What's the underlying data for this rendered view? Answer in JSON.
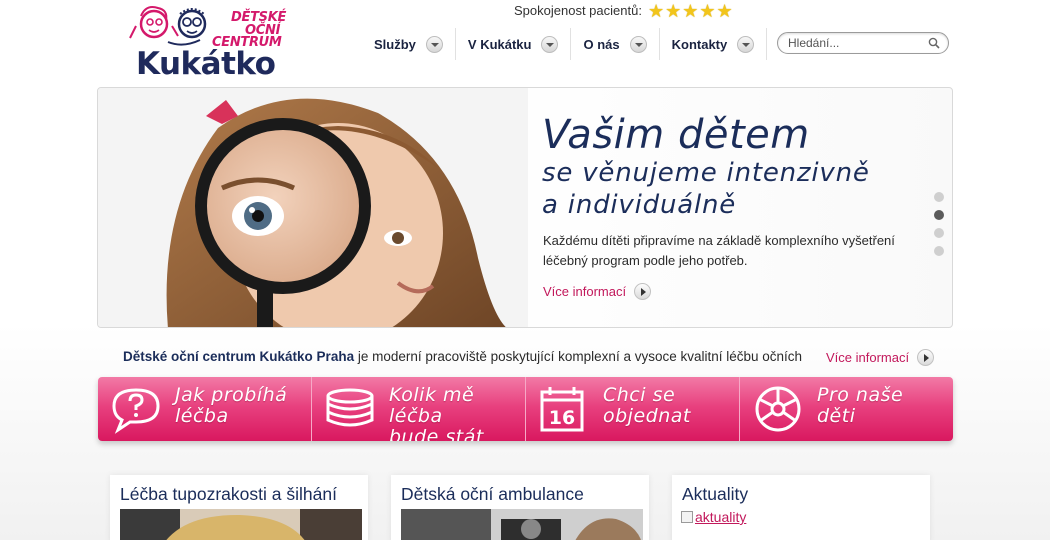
{
  "logo": {
    "line1": "DĚTSKÉ",
    "line2": "OČNÍ",
    "line3": "CENTRUM",
    "brand": "Kukátko"
  },
  "rating": {
    "label": "Spokojenost pacientů:",
    "stars": 5
  },
  "nav": {
    "items": [
      {
        "label": "Služby"
      },
      {
        "label": "V Kukátku"
      },
      {
        "label": "O nás"
      },
      {
        "label": "Kontakty"
      }
    ]
  },
  "search": {
    "placeholder": "Hledání..."
  },
  "hero": {
    "title_line1": "Vašim dětem",
    "title_line2": "se věnujeme intenzivně",
    "title_line3": "a individuálně",
    "text": "Každému dítěti připravíme na základě komplexního vyšetření léčebný program podle jeho potřeb.",
    "more": "Více informací",
    "slides": 4,
    "active_slide": 2
  },
  "intro": {
    "bold": "Dětské oční centrum Kukátko Praha",
    "text": " je moderní pracoviště poskytující komplexní a vysoce kvalitní léčbu očních",
    "more": "Více informací"
  },
  "tiles": [
    {
      "line1": "Jak probíhá",
      "line2": "léčba",
      "icon": "speech-bubble-question-icon"
    },
    {
      "line1": "Kolik mě léčba",
      "line2": "bude stát",
      "icon": "coins-icon"
    },
    {
      "line1": "Chci se",
      "line2": "objednat",
      "icon": "calendar-icon",
      "icon_text": "16"
    },
    {
      "line1": "Pro naše",
      "line2": "děti",
      "icon": "ball-icon"
    }
  ],
  "boxes": {
    "treatment": {
      "title": "Léčba tupozrakosti a šilhání"
    },
    "ambulance": {
      "title": "Dětská oční ambulance"
    },
    "news": {
      "title": "Aktuality",
      "image_alt": "aktuality"
    }
  },
  "colors": {
    "brand_navy": "#1b2d5a",
    "brand_pink": "#d4196b",
    "tile_pink": "#e8417f"
  }
}
